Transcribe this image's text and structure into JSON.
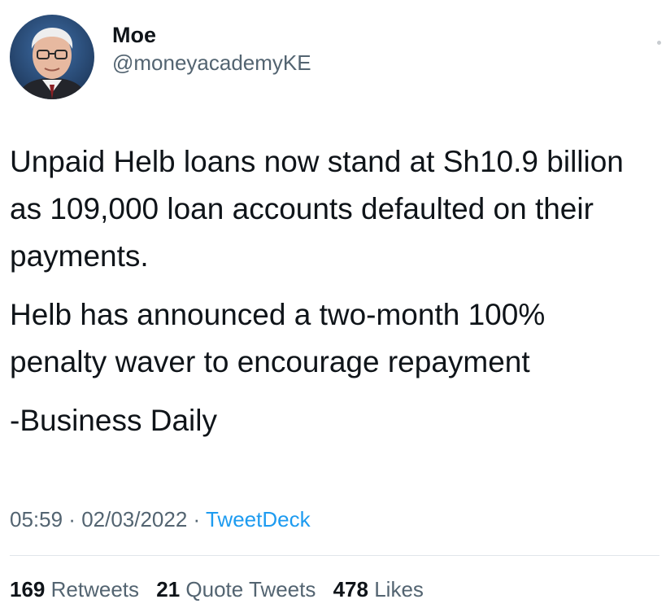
{
  "author": {
    "display_name": "Moe",
    "handle": "@moneyacademyKE",
    "avatar_icon": "user-avatar"
  },
  "tweet": {
    "paragraphs": [
      "Unpaid Helb loans now stand at Sh10.9 billion as 109,000 loan accounts defaulted on their payments.",
      "Helb has announced a two-month 100% penalty waver to encourage repayment",
      "-Business Daily"
    ]
  },
  "meta": {
    "time": "05:59",
    "separator1": " · ",
    "date": "02/03/2022",
    "separator2": " · ",
    "source": "TweetDeck"
  },
  "stats": {
    "retweets_count": "169",
    "retweets_label": "Retweets",
    "quotes_count": "21",
    "quotes_label": "Quote Tweets",
    "likes_count": "478",
    "likes_label": "Likes"
  },
  "colors": {
    "text": "#0f1419",
    "secondary": "#536471",
    "link": "#1d9bf0"
  }
}
